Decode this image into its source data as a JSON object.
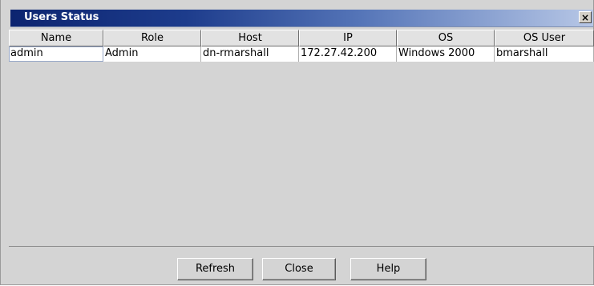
{
  "window": {
    "title": "Users Status",
    "close_glyph": "×"
  },
  "table": {
    "columns": [
      "Name",
      "Role",
      "Host",
      "IP",
      "OS",
      "OS User"
    ],
    "rows": [
      [
        "admin",
        "Admin",
        "dn-rmarshall",
        "172.27.42.200",
        "Windows 2000",
        "bmarshall"
      ]
    ]
  },
  "buttons": {
    "refresh": "Refresh",
    "close": "Close",
    "help": "Help"
  },
  "colors": {
    "title_start": "#0c2470",
    "title_end": "#b7c7e6",
    "panel": "#d4d4d4"
  }
}
